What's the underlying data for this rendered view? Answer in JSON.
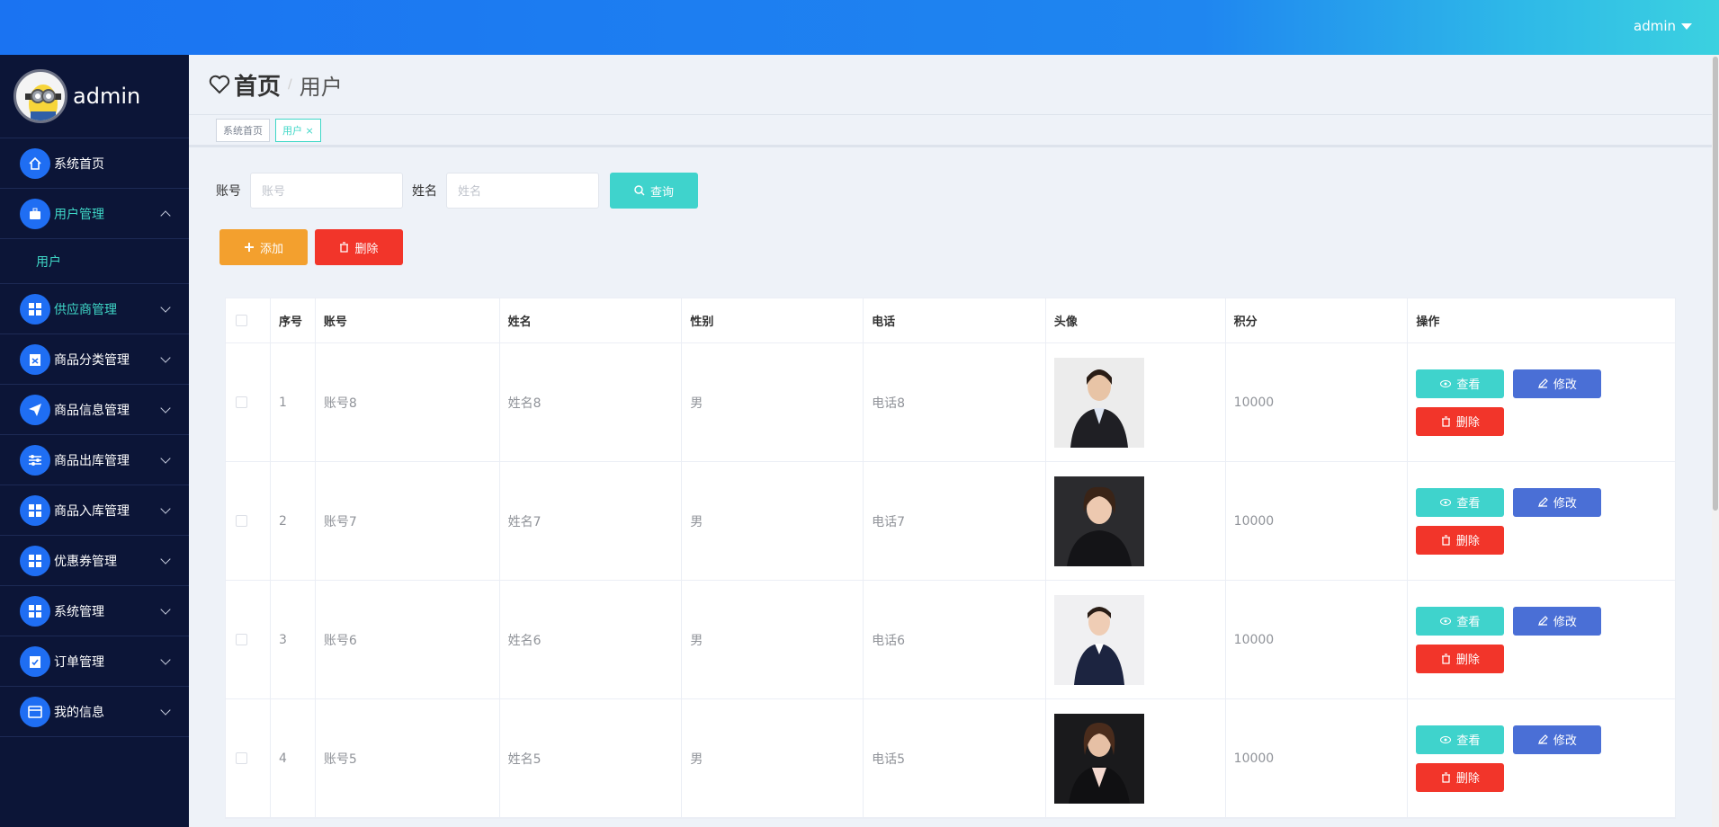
{
  "header": {
    "user": "admin"
  },
  "sidebar": {
    "brand": "admin",
    "items": [
      {
        "label": "系统首页",
        "icon": "home-icon"
      },
      {
        "label": "用户管理",
        "icon": "briefcase-icon",
        "expanded": true
      },
      {
        "label": "用户",
        "icon": "",
        "sub": true
      },
      {
        "label": "供应商管理",
        "icon": "grid-icon"
      },
      {
        "label": "商品分类管理",
        "icon": "clipboard-icon"
      },
      {
        "label": "商品信息管理",
        "icon": "send-icon"
      },
      {
        "label": "商品出库管理",
        "icon": "sliders-icon"
      },
      {
        "label": "商品入库管理",
        "icon": "grid-icon"
      },
      {
        "label": "优惠券管理",
        "icon": "grid-icon"
      },
      {
        "label": "系统管理",
        "icon": "grid-icon"
      },
      {
        "label": "订单管理",
        "icon": "clipboard-check-icon"
      },
      {
        "label": "我的信息",
        "icon": "wallet-icon"
      }
    ]
  },
  "breadcrumb": {
    "home": "首页",
    "sep": "/",
    "current": "用户"
  },
  "tags": {
    "home": "系统首页",
    "current": "用户",
    "close": "×"
  },
  "search": {
    "account_label": "账号",
    "account_placeholder": "账号",
    "name_label": "姓名",
    "name_placeholder": "姓名",
    "query_button": "查询"
  },
  "actions": {
    "add": "添加",
    "delete": "删除"
  },
  "table": {
    "headers": [
      "序号",
      "账号",
      "姓名",
      "性别",
      "电话",
      "头像",
      "积分",
      "操作"
    ],
    "rows": [
      {
        "index": "1",
        "account": "账号8",
        "name": "姓名8",
        "gender": "男",
        "phone": "电话8",
        "points": "10000"
      },
      {
        "index": "2",
        "account": "账号7",
        "name": "姓名7",
        "gender": "男",
        "phone": "电话7",
        "points": "10000"
      },
      {
        "index": "3",
        "account": "账号6",
        "name": "姓名6",
        "gender": "男",
        "phone": "电话6",
        "points": "10000"
      },
      {
        "index": "4",
        "account": "账号5",
        "name": "姓名5",
        "gender": "男",
        "phone": "电话5",
        "points": "10000"
      }
    ],
    "row_actions": {
      "view": "查看",
      "edit": "修改",
      "delete": "删除"
    }
  },
  "colors": {
    "accent": "#3fd3cc",
    "primary": "#1f6ef3",
    "danger": "#f2352a",
    "warning": "#f3a02e",
    "sidebar_bg": "#0c1537"
  }
}
